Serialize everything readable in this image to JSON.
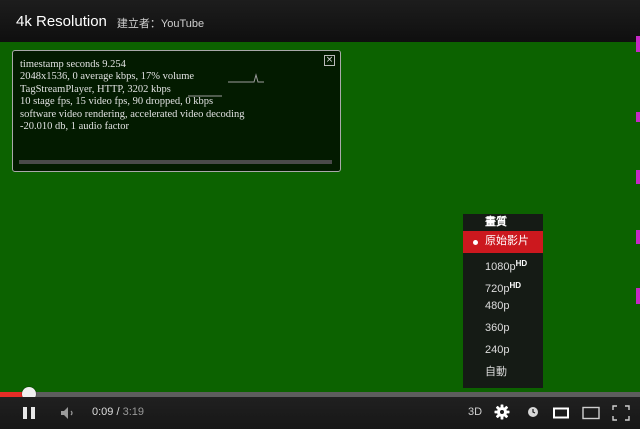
{
  "header": {
    "title": "4k Resolution",
    "uploader": "建立者：YouTube"
  },
  "stats_overlay": {
    "lines": [
      "timestamp seconds 9.254",
      "2048x1536, 0 average kbps, 17% volume",
      "TagStreamPlayer, HTTP, 3202 kbps",
      "10 stage fps, 15 video fps, 90 dropped, 0 kbps",
      "software video rendering, accelerated video decoding",
      "-20.010 db, 1 audio factor"
    ],
    "close_glyph": "×"
  },
  "quality_menu": {
    "title": "畫質",
    "items": [
      {
        "label": "原始影片",
        "hd": "",
        "selected": true
      },
      {
        "label": "1080p",
        "hd": "HD",
        "selected": false
      },
      {
        "label": "720p",
        "hd": "HD",
        "selected": false
      },
      {
        "label": "480p",
        "hd": "",
        "selected": false
      },
      {
        "label": "360p",
        "hd": "",
        "selected": false
      },
      {
        "label": "240p",
        "hd": "",
        "selected": false
      },
      {
        "label": "自動",
        "hd": "",
        "selected": false
      }
    ]
  },
  "controls": {
    "current_time": "0:09",
    "separator": " / ",
    "total_time": "3:19",
    "label_3d": "3D",
    "icons": {
      "play_pause": "pause-icon",
      "volume": "volume-icon",
      "settings": "gear-icon",
      "watch_later": "clock-icon",
      "small_player": "small-player-icon",
      "large_player": "large-player-icon",
      "fullscreen": "fullscreen-icon"
    }
  },
  "progress": {
    "played_fraction": 0.047
  },
  "colors": {
    "video_background": "#0c6200",
    "progress_played": "#e52d27",
    "menu_selected": "#cc181e",
    "edge_marker": "#c528c5"
  }
}
